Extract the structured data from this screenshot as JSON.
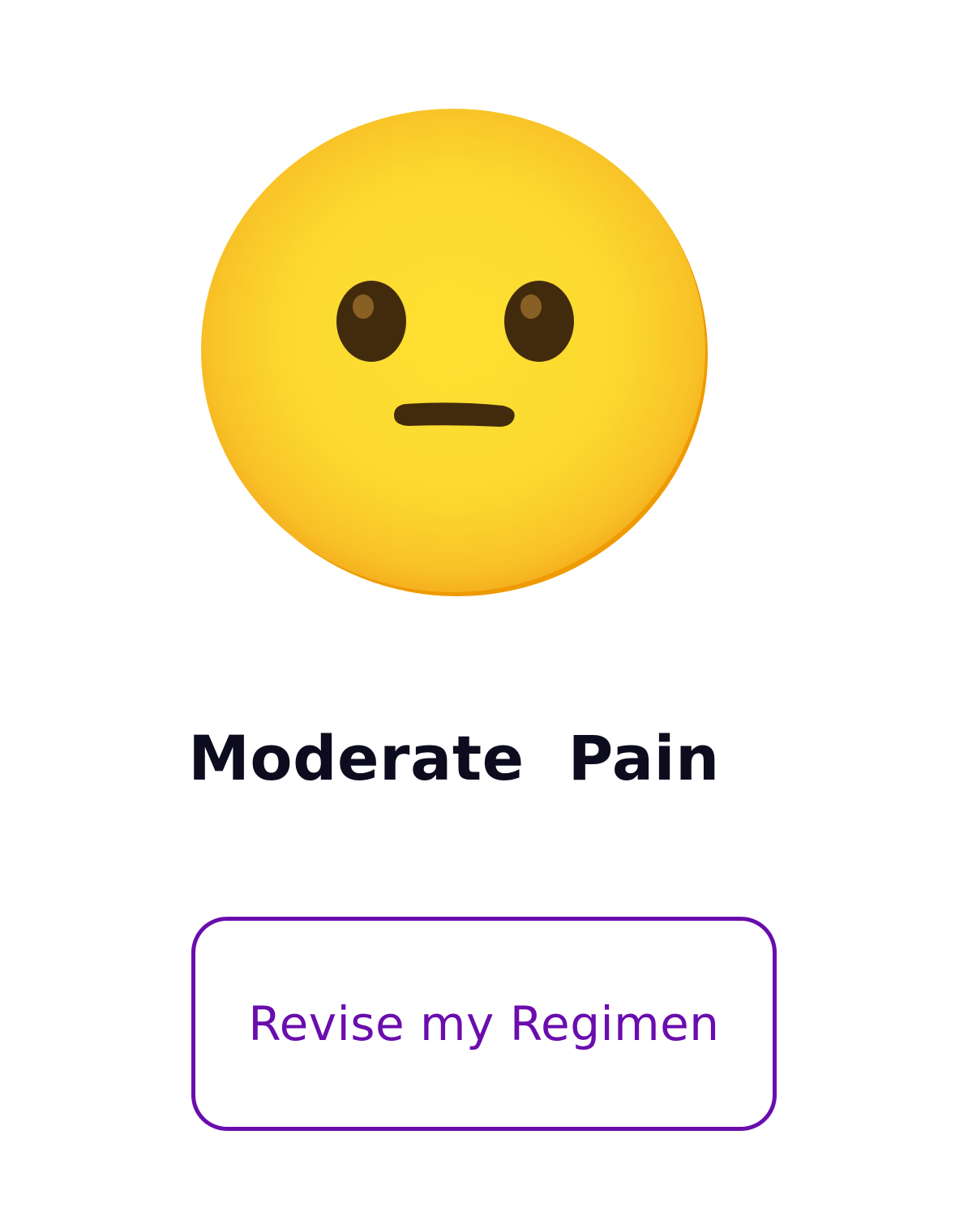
{
  "emoji": {
    "icon": "neutral-face-icon",
    "colors": {
      "face_center": "#fde032",
      "face_edge": "#f6ad1f",
      "shadow": "#ee9a00",
      "features": "#422b0d",
      "eye_highlight": "#896024"
    }
  },
  "pain_level": {
    "label": "Moderate  Pain"
  },
  "action": {
    "revise_label": "Revise my Regimen",
    "accent_color": "#6a0dad"
  }
}
